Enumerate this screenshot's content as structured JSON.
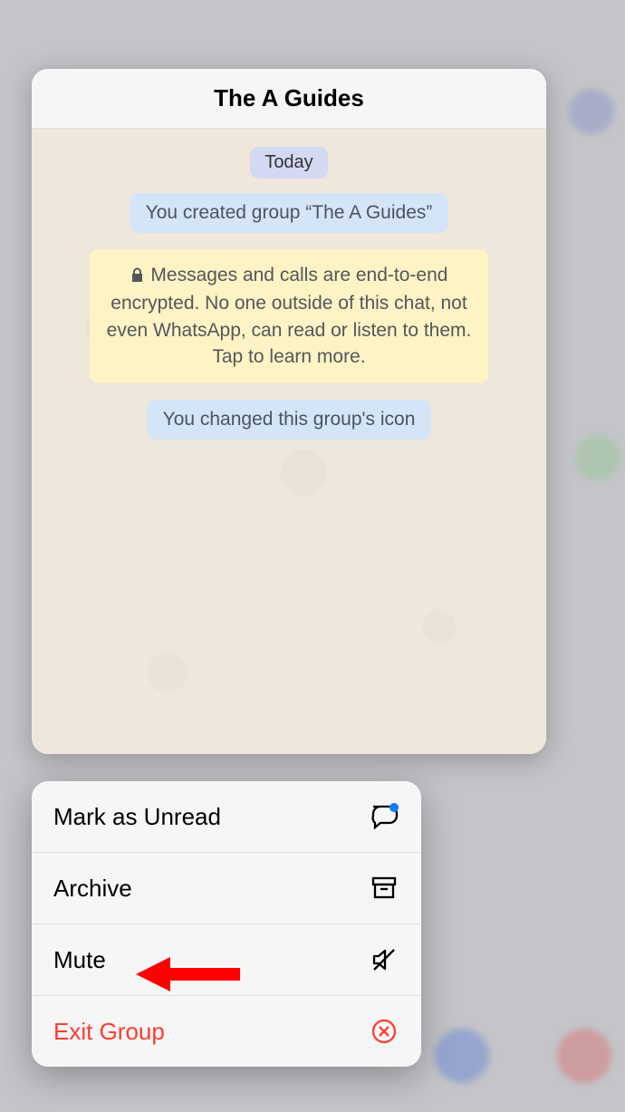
{
  "chat": {
    "title": "The A Guides",
    "date_label": "Today",
    "system_messages": [
      "You created group “The A Guides”",
      "You changed this group's icon"
    ],
    "encryption_notice": "Messages and calls are end-to-end encrypted. No one outside of this chat, not even WhatsApp, can read or listen to them. Tap to learn more."
  },
  "menu": {
    "mark_unread": "Mark as Unread",
    "archive": "Archive",
    "mute": "Mute",
    "exit_group": "Exit Group"
  },
  "colors": {
    "danger": "#ff3b30"
  }
}
